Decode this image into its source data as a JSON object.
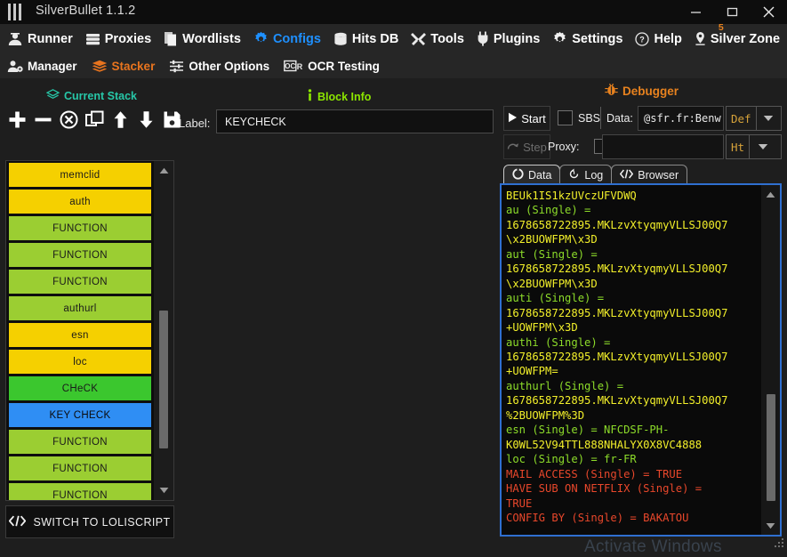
{
  "window": {
    "title": "SilverBullet 1.1.2",
    "logo_icon": "silverbullet-logo-icon",
    "minimize_label": "–",
    "maximize_label": "▭",
    "close_label": "✕"
  },
  "menu_primary": [
    {
      "label": "Runner",
      "icon": "runner-icon",
      "active": false
    },
    {
      "label": "Proxies",
      "icon": "server-icon",
      "active": false
    },
    {
      "label": "Wordlists",
      "icon": "files-icon",
      "active": false
    },
    {
      "label": "Configs",
      "icon": "gear-icon",
      "active": true
    },
    {
      "label": "Hits DB",
      "icon": "database-icon",
      "active": false
    },
    {
      "label": "Tools",
      "icon": "tools-icon",
      "active": false
    },
    {
      "label": "Plugins",
      "icon": "plug-icon",
      "active": false
    },
    {
      "label": "Settings",
      "icon": "cog-icon",
      "active": false
    },
    {
      "label": "Help",
      "icon": "question-circle-icon",
      "active": false
    },
    {
      "label": "Silver Zone",
      "icon": "location-pin-icon",
      "active": false,
      "badge": "5"
    }
  ],
  "menu_icons": [
    {
      "name": "history-icon"
    },
    {
      "name": "camera-icon"
    },
    {
      "name": "discord-icon"
    },
    {
      "name": "telegram-icon"
    }
  ],
  "menu_secondary": [
    {
      "label": "Manager",
      "icon": "user-cog-icon",
      "active": false
    },
    {
      "label": "Stacker",
      "icon": "layers-icon",
      "active": true
    },
    {
      "label": "Other Options",
      "icon": "sliders-icon",
      "active": false
    },
    {
      "label": "OCR Testing",
      "icon": "ocr-icon",
      "active": false
    }
  ],
  "headings": {
    "current_stack": "Current Stack",
    "current_stack_icon": "stack-icon",
    "block_info": "Block Info",
    "block_info_icon": "info-icon",
    "debugger": "Debugger",
    "debugger_icon": "bug-icon"
  },
  "stack_toolbar": [
    {
      "name": "add-block-button",
      "icon": "plus-icon"
    },
    {
      "name": "remove-block-button",
      "icon": "minus-icon"
    },
    {
      "name": "clear-stack-button",
      "icon": "circle-x-icon"
    },
    {
      "name": "duplicate-block-button",
      "icon": "copy-icon"
    },
    {
      "name": "move-up-button",
      "icon": "arrow-up-icon"
    },
    {
      "name": "move-down-button",
      "icon": "arrow-down-icon"
    },
    {
      "name": "save-config-button",
      "icon": "save-icon"
    }
  ],
  "block_info": {
    "label_caption": "Label:",
    "label_value": "KEYCHECK",
    "label_placeholder": ""
  },
  "stack_items": [
    {
      "label": "memclid",
      "color": "#f5d000"
    },
    {
      "label": "auth",
      "color": "#f5d000"
    },
    {
      "label": "FUNCTION",
      "color": "#9bce32"
    },
    {
      "label": "FUNCTION",
      "color": "#9bce32"
    },
    {
      "label": "FUNCTION",
      "color": "#9bce32"
    },
    {
      "label": "authurl",
      "color": "#9bce32"
    },
    {
      "label": "esn",
      "color": "#f5d000"
    },
    {
      "label": "loc",
      "color": "#f5d000"
    },
    {
      "label": "CHeCK",
      "color": "#3bc72e"
    },
    {
      "label": "KEY CHECK",
      "color": "#2f8ef4",
      "selected": true
    },
    {
      "label": "FUNCTION",
      "color": "#9bce32"
    },
    {
      "label": "FUNCTION",
      "color": "#9bce32"
    },
    {
      "label": "FUNCTION",
      "color": "#9bce32"
    }
  ],
  "switch_button": {
    "label": "SWITCH TO LOLISCRIPT",
    "icon": "code-icon"
  },
  "debugger": {
    "start_label": "Start",
    "start_icon": "play-icon",
    "step_label": "Step",
    "step_icon": "step-over-icon",
    "sbs_label": "SBS",
    "sbs_checked": false,
    "data_label": "Data:",
    "data_value": "@sfr.fr:Benwa",
    "data_placeholder": "",
    "proxy_label": "Proxy:",
    "proxy_checked": false,
    "proxy_state": "OFF",
    "proxy_value": "",
    "proxy_placeholder": "",
    "data_type": "Def",
    "proxy_type": "Ht"
  },
  "tabs": [
    {
      "label": "Data",
      "icon": "circle-icon",
      "active": true
    },
    {
      "label": "Log",
      "icon": "history-icon",
      "active": false
    },
    {
      "label": "Browser",
      "icon": "code-icon",
      "active": false
    }
  ],
  "log_lines": [
    {
      "text": "BEUk1IS1kzUVczUFVDWQ",
      "color": "yellow"
    },
    {
      "text": "au (Single) =",
      "color": "green"
    },
    {
      "text": "1678658722895.MKLzvXtyqmyVLLSJ00Q7",
      "color": "yellow"
    },
    {
      "text": "\\x2BUOWFPM\\x3D",
      "color": "yellow"
    },
    {
      "text": "aut (Single) =",
      "color": "green"
    },
    {
      "text": "1678658722895.MKLzvXtyqmyVLLSJ00Q7",
      "color": "yellow"
    },
    {
      "text": "\\x2BUOWFPM\\x3D",
      "color": "yellow"
    },
    {
      "text": "auti (Single) =",
      "color": "green"
    },
    {
      "text": "1678658722895.MKLzvXtyqmyVLLSJ00Q7",
      "color": "yellow"
    },
    {
      "text": "+UOWFPM\\x3D",
      "color": "yellow"
    },
    {
      "text": "authi (Single) =",
      "color": "green"
    },
    {
      "text": "1678658722895.MKLzvXtyqmyVLLSJ00Q7",
      "color": "yellow"
    },
    {
      "text": "+UOWFPM=",
      "color": "yellow"
    },
    {
      "text": "authurl (Single) =",
      "color": "green"
    },
    {
      "text": "1678658722895.MKLzvXtyqmyVLLSJ00Q7",
      "color": "yellow"
    },
    {
      "text": "%2BUOWFPM%3D",
      "color": "yellow"
    },
    {
      "text": "esn (Single) = NFCDSF-PH-",
      "color": "green"
    },
    {
      "text": "K0WL52V94TTL888NHALYX0X8VC4888",
      "color": "yellow"
    },
    {
      "text": "loc (Single) = fr-FR",
      "color": "green"
    },
    {
      "text": "MAIL ACCESS (Single) = TRUE",
      "color": "red"
    },
    {
      "text": "HAVE SUB ON NETFLIX (Single) =",
      "color": "red"
    },
    {
      "text": "TRUE",
      "color": "red"
    },
    {
      "text": "CONFIG BY (Single) = BAKATOU",
      "color": "red"
    }
  ],
  "watermark": "Activate Windows",
  "colors": {
    "accent_blue": "#1e90ff",
    "accent_orange": "#e8741e",
    "stack_green": "#8ce600",
    "teal": "#27c7a8",
    "focus_border": "#2f6fd0"
  }
}
